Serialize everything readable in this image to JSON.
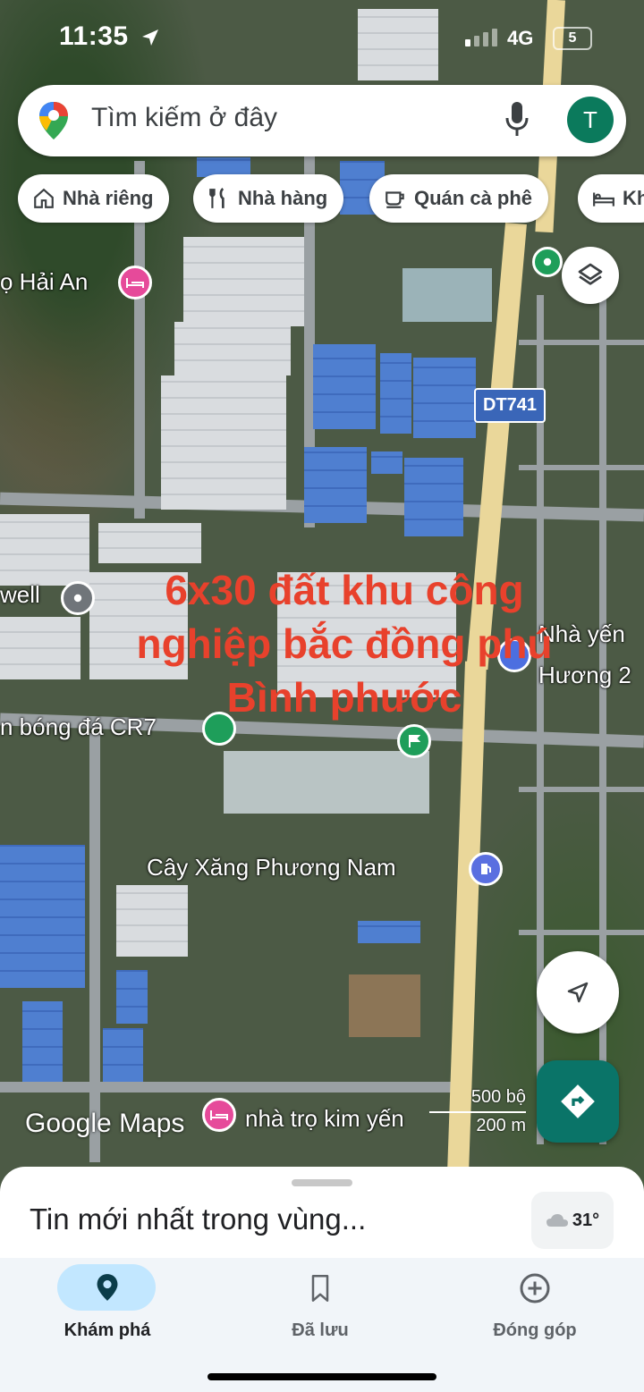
{
  "status_bar": {
    "time": "11:35",
    "network": "4G",
    "battery": "5"
  },
  "search": {
    "placeholder": "Tìm kiếm ở đây",
    "avatar_letter": "T"
  },
  "chips": [
    {
      "label": "Nhà riêng",
      "icon": "home-icon"
    },
    {
      "label": "Nhà hàng",
      "icon": "restaurant-icon"
    },
    {
      "label": "Quán cà phê",
      "icon": "coffee-icon"
    },
    {
      "label": "Kh",
      "icon": "hotel-icon"
    }
  ],
  "map": {
    "labels": {
      "hai_an": "ọ Hải An",
      "well": "well",
      "nha_yen": "Nhà yến",
      "huong": "Hương 2",
      "cr7": "n bóng đá CR7",
      "gas_station": "Cây Xăng Phương Nam",
      "kimyen": "nhà trọ kim yến"
    },
    "road_shield": "DT741",
    "overlay_text": [
      "6x30 đất khu công",
      "nghiệp bắc đồng phú",
      "Bình phước"
    ],
    "attribution": "Google Maps",
    "scale": {
      "imperial": "500 bộ",
      "metric": "200 m"
    }
  },
  "sheet": {
    "headline": "Tin mới nhất trong vùng...",
    "temperature": "31°"
  },
  "bottom_nav": [
    {
      "label": "Khám phá",
      "icon": "explore-pin-icon",
      "active": true
    },
    {
      "label": "Đã lưu",
      "icon": "bookmark-icon",
      "active": false
    },
    {
      "label": "Đóng góp",
      "icon": "add-circle-icon",
      "active": false
    }
  ],
  "colors": {
    "overlay_text": "#e8412c",
    "directions_fab": "#0a7468",
    "nav_active_pill": "#c2e7ff",
    "avatar": "#0b7a5c"
  }
}
